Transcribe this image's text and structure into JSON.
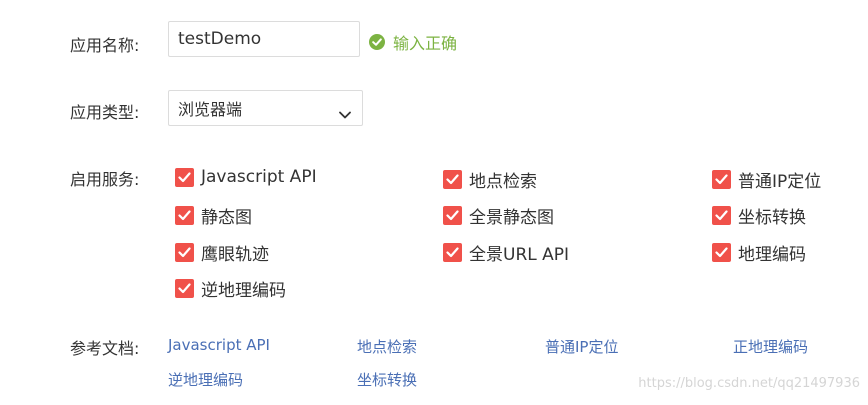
{
  "app_name": {
    "label": "应用名称:",
    "value": "testDemo",
    "validation": "输入正确"
  },
  "app_type": {
    "label": "应用类型:",
    "selected": "浏览器端"
  },
  "services": {
    "label": "启用服务:",
    "items": [
      {
        "label": "Javascript API",
        "checked": true
      },
      {
        "label": "地点检索",
        "checked": true
      },
      {
        "label": "普通IP定位",
        "checked": true
      },
      {
        "label": "静态图",
        "checked": true
      },
      {
        "label": "全景静态图",
        "checked": true
      },
      {
        "label": "坐标转换",
        "checked": true
      },
      {
        "label": "鹰眼轨迹",
        "checked": true
      },
      {
        "label": "全景URL API",
        "checked": true
      },
      {
        "label": "地理编码",
        "checked": true
      },
      {
        "label": "逆地理编码",
        "checked": true
      }
    ]
  },
  "docs": {
    "label": "参考文档:",
    "links": [
      "Javascript API",
      "地点检索",
      "普通IP定位",
      "正地理编码",
      "逆地理编码",
      "坐标转换"
    ]
  },
  "watermark": "https://blog.csdn.net/qq21497936",
  "colors": {
    "checkbox": "#f0514a",
    "valid": "#7cb342",
    "link": "#4a6fb5"
  }
}
